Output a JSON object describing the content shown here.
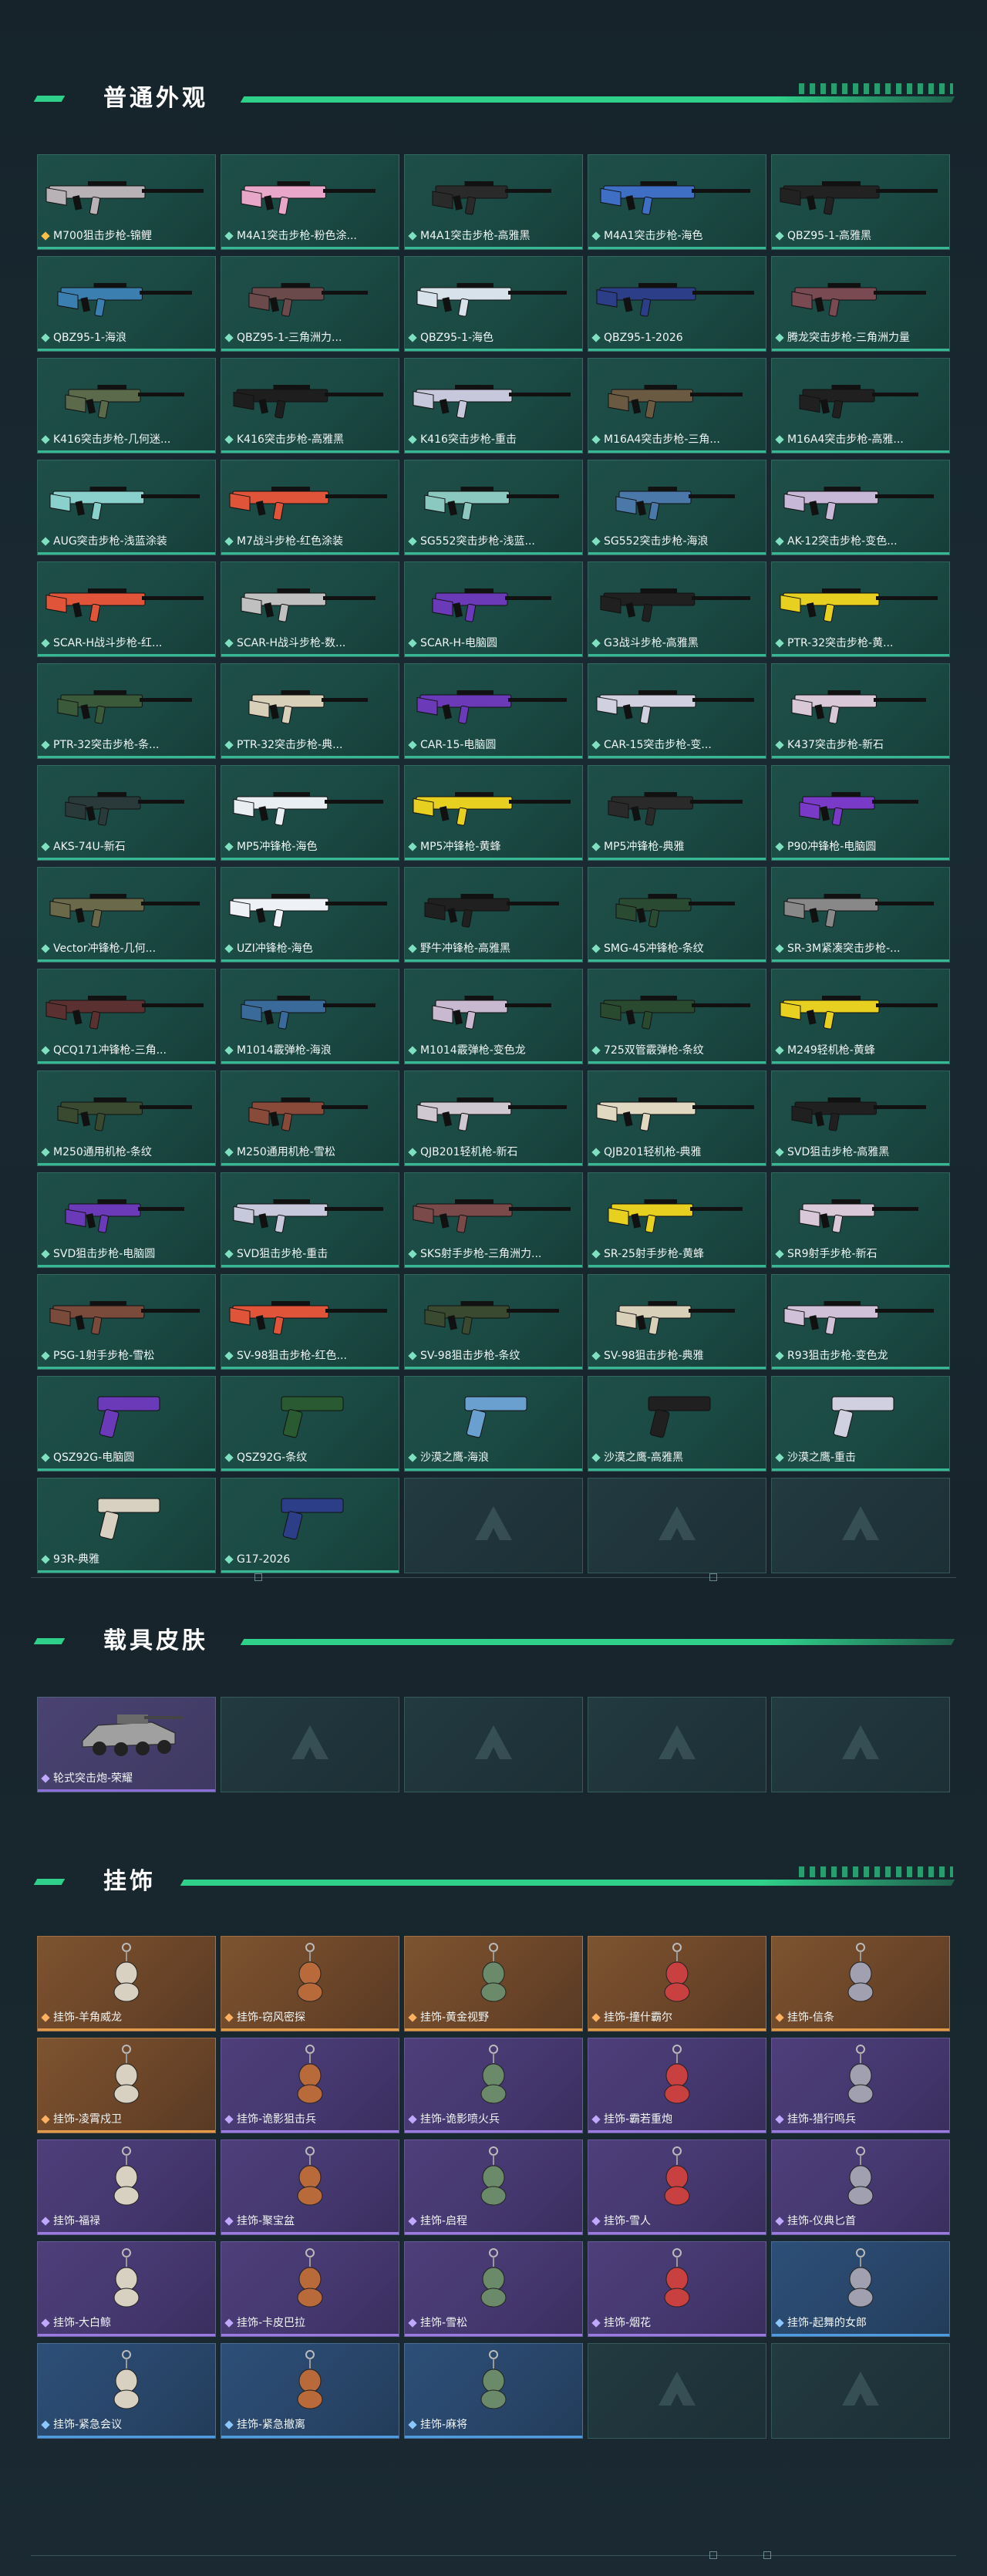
{
  "sections": {
    "weapons_title": "普通外观",
    "vehicle_title": "载具皮肤",
    "charm_title": "挂饰"
  },
  "weapons": [
    {
      "label": "M700狙击步枪-锦鲤",
      "color": "#b8b2b6"
    },
    {
      "label": "M4A1突击步枪-粉色涂...",
      "color": "#e8a6c8"
    },
    {
      "label": "M4A1突击步枪-高雅黑",
      "color": "#2a2a2a"
    },
    {
      "label": "M4A1突击步枪-海色",
      "color": "#3e6fc4"
    },
    {
      "label": "QBZ95-1-高雅黑",
      "color": "#222222"
    },
    {
      "label": "QBZ95-1-海浪",
      "color": "#3a7fb0"
    },
    {
      "label": "QBZ95-1-三角洲力...",
      "color": "#6a4a4a"
    },
    {
      "label": "QBZ95-1-海色",
      "color": "#d8e2ea"
    },
    {
      "label": "QBZ95-1-2026",
      "color": "#2c3e88"
    },
    {
      "label": "腾龙突击步枪-三角洲力量",
      "color": "#7a4a52"
    },
    {
      "label": "K416突击步枪-几何迷...",
      "color": "#5a6a4a"
    },
    {
      "label": "K416突击步枪-高雅黑",
      "color": "#1e1e1e"
    },
    {
      "label": "K416突击步枪-重击",
      "color": "#c8c8dc"
    },
    {
      "label": "M16A4突击步枪-三角...",
      "color": "#6a5a42"
    },
    {
      "label": "M16A4突击步枪-高雅...",
      "color": "#202020"
    },
    {
      "label": "AUG突击步枪-浅蓝涂装",
      "color": "#8ad0cc"
    },
    {
      "label": "M7战斗步枪-红色涂装",
      "color": "#e0553a"
    },
    {
      "label": "SG552突击步枪-浅蓝...",
      "color": "#8ac8c0"
    },
    {
      "label": "SG552突击步枪-海浪",
      "color": "#4a78a8"
    },
    {
      "label": "AK-12突击步枪-变色...",
      "color": "#c8b8d8"
    },
    {
      "label": "SCAR-H战斗步枪-红...",
      "color": "#e0553a"
    },
    {
      "label": "SCAR-H战斗步枪-数...",
      "color": "#c0c0c0"
    },
    {
      "label": "SCAR-H-电脑圆",
      "color": "#6a3ab8"
    },
    {
      "label": "G3战斗步枪-高雅黑",
      "color": "#202020"
    },
    {
      "label": "PTR-32突击步枪-黄...",
      "color": "#e8d020"
    },
    {
      "label": "PTR-32突击步枪-条...",
      "color": "#3a5a3a"
    },
    {
      "label": "PTR-32突击步枪-典...",
      "color": "#d8d0b8"
    },
    {
      "label": "CAR-15-电脑圆",
      "color": "#6a3ab8"
    },
    {
      "label": "CAR-15突击步枪-变...",
      "color": "#d0d0e0"
    },
    {
      "label": "K437突击步枪-新石",
      "color": "#d8c8d8"
    },
    {
      "label": "AKS-74U-新石",
      "color": "#2a3a3a"
    },
    {
      "label": "MP5冲锋枪-海色",
      "color": "#e8eef2"
    },
    {
      "label": "MP5冲锋枪-黄蜂",
      "color": "#e8d020"
    },
    {
      "label": "MP5冲锋枪-典雅",
      "color": "#2a2a2a"
    },
    {
      "label": "P90冲锋枪-电脑圆",
      "color": "#7a3ac8"
    },
    {
      "label": "Vector冲锋枪-几何...",
      "color": "#6a6a4a"
    },
    {
      "label": "UZI冲锋枪-海色",
      "color": "#eef2f6"
    },
    {
      "label": "野牛冲锋枪-高雅黑",
      "color": "#202020"
    },
    {
      "label": "SMG-45冲锋枪-条纹",
      "color": "#2a4a32"
    },
    {
      "label": "SR-3M紧凑突击步枪-...",
      "color": "#888888"
    },
    {
      "label": "QCQ171冲锋枪-三角...",
      "color": "#5a3030"
    },
    {
      "label": "M1014霰弹枪-海浪",
      "color": "#3a6a9a"
    },
    {
      "label": "M1014霰弹枪-变色龙",
      "color": "#c8b8d0"
    },
    {
      "label": "725双管霰弹枪-条纹",
      "color": "#2a4a30"
    },
    {
      "label": "M249轻机枪-黄蜂",
      "color": "#e8d020"
    },
    {
      "label": "M250通用机枪-条纹",
      "color": "#3a4a30"
    },
    {
      "label": "M250通用机枪-雪松",
      "color": "#8a4a3a"
    },
    {
      "label": "QJB201轻机枪-新石",
      "color": "#d0c8d0"
    },
    {
      "label": "QJB201轻机枪-典雅",
      "color": "#e0d8c0"
    },
    {
      "label": "SVD狙击步枪-高雅黑",
      "color": "#202020"
    },
    {
      "label": "SVD狙击步枪-电脑圆",
      "color": "#6a3ab8"
    },
    {
      "label": "SVD狙击步枪-重击",
      "color": "#c8c8dc"
    },
    {
      "label": "SKS射手步枪-三角洲力...",
      "color": "#7a4a4a"
    },
    {
      "label": "SR-25射手步枪-黄蜂",
      "color": "#e8d020"
    },
    {
      "label": "SR9射手步枪-新石",
      "color": "#d8c8d8"
    },
    {
      "label": "PSG-1射手步枪-雪松",
      "color": "#7a4a3a"
    },
    {
      "label": "SV-98狙击步枪-红色...",
      "color": "#e0553a"
    },
    {
      "label": "SV-98狙击步枪-条纹",
      "color": "#3a4a30"
    },
    {
      "label": "SV-98狙击步枪-典雅",
      "color": "#d8d0b8"
    },
    {
      "label": "R93狙击步枪-变色龙",
      "color": "#d0c0d8"
    },
    {
      "label": "QSZ92G-电脑圆",
      "color": "#6a3ab8"
    },
    {
      "label": "QSZ92G-条纹",
      "color": "#2a5a32"
    },
    {
      "label": "沙漠之鹰-海浪",
      "color": "#6aa0d0"
    },
    {
      "label": "沙漠之鹰-高雅黑",
      "color": "#202020"
    },
    {
      "label": "沙漠之鹰-重击",
      "color": "#d0d0e0"
    },
    {
      "label": "93R-典雅",
      "color": "#d8d0c0"
    },
    {
      "label": "G17-2026",
      "color": "#2c3e88"
    },
    {
      "label": "",
      "color": ""
    },
    {
      "label": "",
      "color": ""
    },
    {
      "label": "",
      "color": ""
    }
  ],
  "vehicles": [
    {
      "label": "轮式突击炮-荣耀",
      "color": "#a0a0a0"
    },
    {
      "label": "",
      "color": ""
    },
    {
      "label": "",
      "color": ""
    },
    {
      "label": "",
      "color": ""
    },
    {
      "label": "",
      "color": ""
    }
  ],
  "charms": [
    {
      "label": "挂饰-羊角威龙",
      "rarity": "gold"
    },
    {
      "label": "挂饰-窃风密探",
      "rarity": "gold"
    },
    {
      "label": "挂饰-黄金视野",
      "rarity": "gold"
    },
    {
      "label": "挂饰-撞什霸尔",
      "rarity": "gold"
    },
    {
      "label": "挂饰-信条",
      "rarity": "gold"
    },
    {
      "label": "挂饰-凌霄戍卫",
      "rarity": "gold"
    },
    {
      "label": "挂饰-诡影狙击兵",
      "rarity": "purple"
    },
    {
      "label": "挂饰-诡影喷火兵",
      "rarity": "purple"
    },
    {
      "label": "挂饰-霸若重炮",
      "rarity": "purple"
    },
    {
      "label": "挂饰-猎行鸣兵",
      "rarity": "purple"
    },
    {
      "label": "挂饰-福禄",
      "rarity": "purple"
    },
    {
      "label": "挂饰-聚宝盆",
      "rarity": "purple"
    },
    {
      "label": "挂饰-启程",
      "rarity": "purple"
    },
    {
      "label": "挂饰-雪人",
      "rarity": "purple"
    },
    {
      "label": "挂饰-仪典匕首",
      "rarity": "purple"
    },
    {
      "label": "挂饰-大白鲸",
      "rarity": "purple"
    },
    {
      "label": "挂饰-卡皮巴拉",
      "rarity": "purple"
    },
    {
      "label": "挂饰-雪松",
      "rarity": "purple"
    },
    {
      "label": "挂饰-烟花",
      "rarity": "purple"
    },
    {
      "label": "挂饰-起舞的女郎",
      "rarity": "blue"
    },
    {
      "label": "挂饰-紧急会议",
      "rarity": "blue"
    },
    {
      "label": "挂饰-紧急撤离",
      "rarity": "blue"
    },
    {
      "label": "挂饰-麻将",
      "rarity": "blue"
    },
    {
      "label": "",
      "rarity": "empty"
    },
    {
      "label": "",
      "rarity": "empty"
    }
  ]
}
